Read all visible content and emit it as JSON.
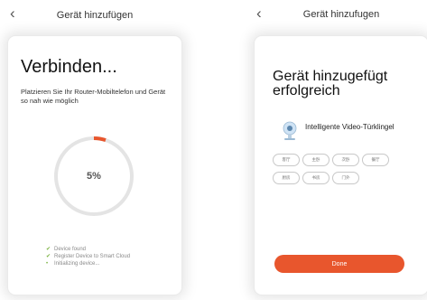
{
  "left_screen": {
    "title": "Gerät hinzufügen",
    "heading": "Verbinden...",
    "instruction": "Platzieren Sie Ihr Router-Mobiltelefon und Gerät so nah wie möglich",
    "progress_percent": 5,
    "progress_label": "5%",
    "accent_color": "#e8562d",
    "steps": [
      {
        "label": "Device found",
        "icon": "check-icon",
        "state": "done"
      },
      {
        "label": "Register Device to Smart Cloud",
        "icon": "check-icon",
        "state": "done"
      },
      {
        "label": "Initializing device...",
        "icon": "dot-icon",
        "state": "active"
      }
    ]
  },
  "right_screen": {
    "title": "Gerät hinzufugen",
    "heading": "Gerät hinzugefügt erfolgreich",
    "device_name": "Intelligente Video-Türklingel",
    "device_icon": "camera-icon",
    "rooms": [
      "客厅",
      "主卧",
      "次卧",
      "餐厅",
      "厨房",
      "书房",
      "门外"
    ],
    "done_label": "Done",
    "button_color": "#e8562d"
  }
}
